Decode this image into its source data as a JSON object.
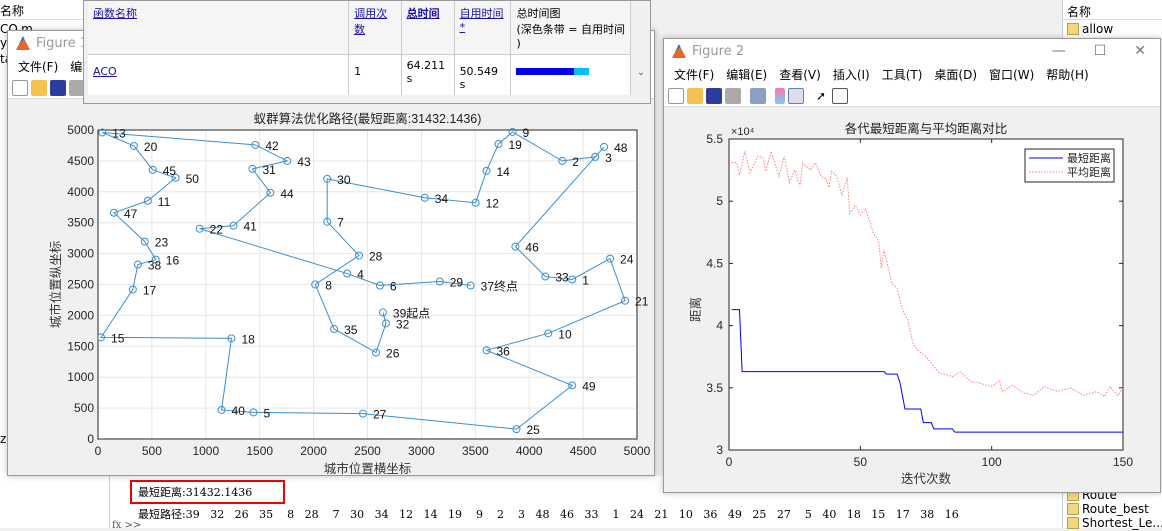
{
  "left_panel": {
    "header": "名称",
    "items": [
      "CO.m",
      "y:",
      "ta"
    ],
    "bottom_fragment": "zi"
  },
  "profiler": {
    "columns": [
      "函数名称",
      "调用次数",
      "总时间",
      "自用时间*",
      "总时间图",
      "(深色条带 = 自用时间",
      ")"
    ],
    "rows": [
      {
        "function": "ACO",
        "calls": "1",
        "total_time": "64.211 s",
        "self_time": "50.549 s",
        "self_fraction": 0.787
      }
    ],
    "bar_colors": {
      "self": "#0000ee",
      "total": "#00c0f0"
    }
  },
  "figure1": {
    "title": "Figure 1",
    "menu": [
      "文件(F)",
      "编辑"
    ],
    "chart": {
      "title": "蚁群算法优化路径(最短距离:31432.1436)",
      "xlabel": "城市位置横坐标",
      "ylabel": "城市位置纵坐标",
      "start_label": "起点",
      "end_label": "终点"
    }
  },
  "figure2": {
    "title": "Figure 2",
    "menu": [
      "文件(F)",
      "编辑(E)",
      "查看(V)",
      "插入(I)",
      "工具(T)",
      "桌面(D)",
      "窗口(W)",
      "帮助(H)"
    ],
    "chart": {
      "title": "各代最短距离与平均距离对比",
      "xlabel": "迭代次数",
      "ylabel": "距离",
      "exponent": "×10⁴",
      "legend": [
        "最短距离",
        "平均距离"
      ]
    }
  },
  "command_window": {
    "shortest_distance": "最短距离:31432.1436",
    "shortest_route": "最短路径:39   32   26   35    8   28    7   30   34   12   14   19    9    2    3   48   46   33    1   24   21   10   36   49   25   27    5   40   18   15   17   38   16",
    "prompt": "fx >>"
  },
  "workspace": {
    "header": "名称",
    "items": [
      "allow",
      "Route",
      "Route_best",
      "Shortest_Le..."
    ]
  },
  "chart_data": [
    {
      "type": "scatter",
      "title": "蚁群算法优化路径(最短距离:31432.1436)",
      "xlabel": "城市位置横坐标",
      "ylabel": "城市位置纵坐标",
      "xlim": [
        0,
        5000
      ],
      "ylim": [
        0,
        5000
      ],
      "xticks": [
        0,
        500,
        1000,
        1500,
        2000,
        2500,
        3000,
        3500,
        4000,
        4500,
        5000
      ],
      "yticks": [
        0,
        500,
        1000,
        1500,
        2000,
        2500,
        3000,
        3500,
        4000,
        4500,
        5000
      ],
      "grid": true,
      "color": "#3a8fd0",
      "cities": {
        "1": [
          4399,
          2581
        ],
        "2": [
          4307,
          4500
        ],
        "3": [
          4612,
          4565
        ],
        "4": [
          2311,
          2677
        ],
        "5": [
          1442,
          430
        ],
        "6": [
          2615,
          2484
        ],
        "7": [
          2126,
          3516
        ],
        "8": [
          2015,
          2500
        ],
        "9": [
          3845,
          4968
        ],
        "10": [
          4177,
          1710
        ],
        "11": [
          462,
          3855
        ],
        "12": [
          3503,
          3823
        ],
        "13": [
          40,
          4960
        ],
        "14": [
          3604,
          4339
        ],
        "15": [
          28,
          1645
        ],
        "16": [
          536,
          2903
        ],
        "17": [
          323,
          2419
        ],
        "18": [
          1238,
          1629
        ],
        "19": [
          3715,
          4774
        ],
        "20": [
          333,
          4742
        ],
        "21": [
          4889,
          2238
        ],
        "22": [
          943,
          3403
        ],
        "23": [
          434,
          3194
        ],
        "24": [
          4750,
          2919
        ],
        "25": [
          3882,
          160
        ],
        "26": [
          2579,
          1399
        ],
        "27": [
          2458,
          410
        ],
        "28": [
          2421,
          2968
        ],
        "29": [
          3170,
          2548
        ],
        "30": [
          2126,
          4210
        ],
        "31": [
          1433,
          4371
        ],
        "32": [
          2671,
          1870
        ],
        "33": [
          4150,
          2629
        ],
        "34": [
          3031,
          3903
        ],
        "35": [
          2190,
          1780
        ],
        "36": [
          3604,
          1435
        ],
        "37": [
          3457,
          2484
        ],
        "38": [
          370,
          2823
        ],
        "39": [
          2643,
          2048
        ],
        "40": [
          1146,
          470
        ],
        "41": [
          1257,
          3452
        ],
        "42": [
          1460,
          4758
        ],
        "43": [
          1756,
          4500
        ],
        "44": [
          1599,
          3984
        ],
        "45": [
          508,
          4355
        ],
        "46": [
          3872,
          3113
        ],
        "47": [
          148,
          3661
        ],
        "48": [
          4695,
          4726
        ],
        "49": [
          4399,
          867
        ],
        "50": [
          720,
          4226
        ]
      },
      "route": [
        39,
        32,
        26,
        35,
        8,
        28,
        7,
        30,
        34,
        12,
        14,
        19,
        9,
        2,
        3,
        48,
        46,
        33,
        1,
        24,
        21,
        10,
        36,
        49,
        25,
        27,
        5,
        40,
        18,
        15,
        17,
        38,
        16,
        23,
        47,
        11,
        50,
        45,
        20,
        13,
        42,
        43,
        31,
        44,
        41,
        22,
        4,
        6,
        29,
        37
      ],
      "start": 39,
      "end": 37
    },
    {
      "type": "line",
      "title": "各代最短距离与平均距离对比",
      "xlabel": "迭代次数",
      "ylabel": "距离",
      "xlim": [
        0,
        150
      ],
      "ylim": [
        30000,
        55000
      ],
      "xticks": [
        0,
        50,
        100,
        150
      ],
      "yticks": [
        3,
        3.5,
        4,
        4.5,
        5,
        5.5
      ],
      "y_multiplier": "×10⁴",
      "legend_position": "top-right",
      "grid": false,
      "series": [
        {
          "name": "最短距离",
          "color": "#0000ff",
          "style": "solid",
          "x": [
            1,
            4,
            5,
            59,
            60,
            64,
            65,
            67,
            73,
            74,
            77,
            78,
            85,
            86,
            150
          ],
          "y": [
            41280,
            41280,
            36300,
            36300,
            36100,
            36100,
            35500,
            33300,
            33300,
            32200,
            32200,
            31700,
            31700,
            31432,
            31432
          ]
        },
        {
          "name": "平均距离",
          "color": "#ff8080",
          "style": "dotted",
          "x": [
            1,
            3,
            4,
            6,
            8,
            11,
            13,
            14,
            16,
            19,
            21,
            23,
            25,
            27,
            28,
            31,
            33,
            35,
            37,
            38,
            39,
            41,
            43,
            45,
            46,
            48,
            50,
            52,
            55,
            57,
            58,
            59,
            62,
            64,
            66,
            68,
            70,
            72,
            75,
            78,
            80,
            85,
            88,
            92,
            95,
            100,
            103,
            104,
            108,
            112,
            116,
            120,
            125,
            130,
            135,
            140,
            143,
            145,
            148,
            150
          ],
          "y": [
            53100,
            53100,
            52100,
            54000,
            52300,
            53600,
            53500,
            52400,
            54000,
            52000,
            53600,
            51500,
            52500,
            51200,
            53100,
            52500,
            53100,
            52000,
            51800,
            51100,
            52400,
            52000,
            50500,
            51900,
            49000,
            49700,
            48900,
            49400,
            47400,
            46800,
            44600,
            46100,
            43400,
            43000,
            41300,
            40500,
            38600,
            38000,
            37500,
            36700,
            36200,
            35900,
            36300,
            35500,
            35400,
            35100,
            35600,
            34700,
            35200,
            34600,
            34400,
            35100,
            34700,
            35000,
            34400,
            34700,
            34300,
            35100,
            34400,
            35000
          ]
        }
      ]
    }
  ]
}
